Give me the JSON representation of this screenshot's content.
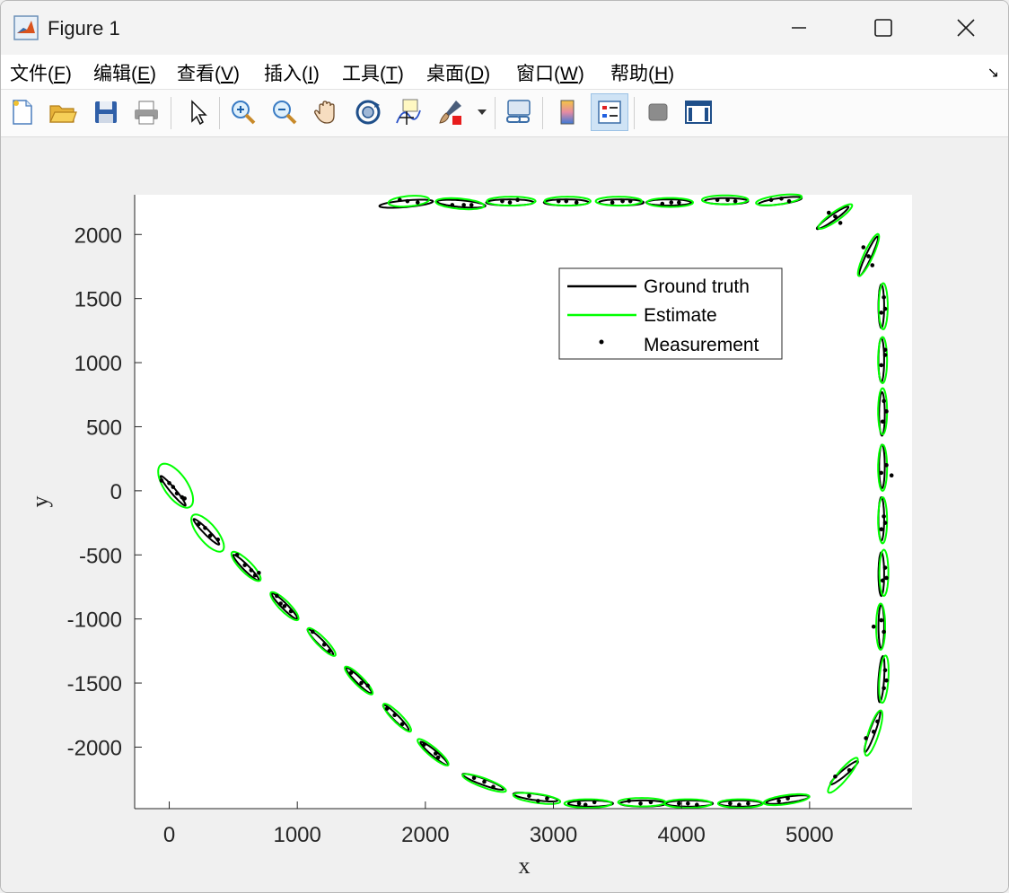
{
  "window": {
    "title": "Figure 1",
    "icon": "matlab-logo-icon"
  },
  "menubar": {
    "items": [
      {
        "label": "文件(",
        "key": "F",
        "tail": ")"
      },
      {
        "label": "编辑(",
        "key": "E",
        "tail": ")"
      },
      {
        "label": "查看(",
        "key": "V",
        "tail": ")"
      },
      {
        "label": "插入(",
        "key": "I",
        "tail": ")"
      },
      {
        "label": "工具(",
        "key": "T",
        "tail": ")"
      },
      {
        "label": "桌面(",
        "key": "D",
        "tail": ")"
      },
      {
        "label": "窗口(",
        "key": "W",
        "tail": ")"
      },
      {
        "label": "帮助(",
        "key": "H",
        "tail": ")"
      }
    ],
    "overflow_icon": "↘"
  },
  "toolbar": {
    "buttons": [
      "new-figure-icon",
      "open-file-icon",
      "save-icon",
      "print-icon",
      "edit-plot-arrow-icon",
      "zoom-in-icon",
      "zoom-out-icon",
      "pan-hand-icon",
      "rotate-3d-icon",
      "data-cursor-icon",
      "brush-icon",
      "link-plot-icon",
      "colorbar-icon",
      "legend-icon",
      "hide-plot-tools-icon",
      "show-plot-tools-icon"
    ],
    "active": "legend-icon"
  },
  "chart_data": {
    "type": "line",
    "xlabel": "x",
    "ylabel": "y",
    "xlim": [
      -270,
      5800
    ],
    "ylim": [
      -2480,
      2310
    ],
    "xticks": [
      0,
      1000,
      2000,
      3000,
      4000,
      5000
    ],
    "yticks": [
      -2000,
      -1500,
      -1000,
      -500,
      0,
      500,
      1000,
      1500,
      2000
    ],
    "legend": {
      "placement": "top-right-inside",
      "entries": [
        "Ground truth",
        "Estimate",
        "Measurement"
      ]
    },
    "colors": {
      "truth": "#000000",
      "estimate": "#00ff00",
      "measurement": "#000000"
    },
    "ground_truth_ellipses": [
      {
        "cx": 30,
        "cy": 0,
        "a": 150,
        "b": 20,
        "angle": -50
      },
      {
        "cx": 290,
        "cy": -320,
        "a": 140,
        "b": 20,
        "angle": -45
      },
      {
        "cx": 600,
        "cy": -600,
        "a": 140,
        "b": 22,
        "angle": -45
      },
      {
        "cx": 900,
        "cy": -900,
        "a": 140,
        "b": 22,
        "angle": -45
      },
      {
        "cx": 1180,
        "cy": -1180,
        "a": 140,
        "b": 22,
        "angle": -45
      },
      {
        "cx": 1480,
        "cy": -1480,
        "a": 140,
        "b": 22,
        "angle": -45
      },
      {
        "cx": 1770,
        "cy": -1770,
        "a": 140,
        "b": 22,
        "angle": -45
      },
      {
        "cx": 2070,
        "cy": -2050,
        "a": 140,
        "b": 22,
        "angle": -40
      },
      {
        "cx": 2450,
        "cy": -2270,
        "a": 170,
        "b": 24,
        "angle": -20
      },
      {
        "cx": 2860,
        "cy": -2390,
        "a": 175,
        "b": 24,
        "angle": -8
      },
      {
        "cx": 3290,
        "cy": -2440,
        "a": 175,
        "b": 24,
        "angle": 0
      },
      {
        "cx": 3700,
        "cy": -2440,
        "a": 180,
        "b": 24,
        "angle": 0
      },
      {
        "cx": 4060,
        "cy": -2440,
        "a": 185,
        "b": 24,
        "angle": 0
      },
      {
        "cx": 4460,
        "cy": -2440,
        "a": 170,
        "b": 24,
        "angle": 0
      },
      {
        "cx": 4830,
        "cy": -2410,
        "a": 170,
        "b": 24,
        "angle": 8
      },
      {
        "cx": 5270,
        "cy": -2200,
        "a": 140,
        "b": 22,
        "angle": 40
      },
      {
        "cx": 5490,
        "cy": -1880,
        "a": 170,
        "b": 22,
        "angle": 70
      },
      {
        "cx": 5560,
        "cy": -1470,
        "a": 180,
        "b": 22,
        "angle": 86
      },
      {
        "cx": 5560,
        "cy": -1060,
        "a": 170,
        "b": 22,
        "angle": 90
      },
      {
        "cx": 5560,
        "cy": -650,
        "a": 170,
        "b": 22,
        "angle": 90
      },
      {
        "cx": 5560,
        "cy": -220,
        "a": 170,
        "b": 22,
        "angle": 90
      },
      {
        "cx": 5565,
        "cy": 190,
        "a": 170,
        "b": 22,
        "angle": 90
      },
      {
        "cx": 5565,
        "cy": 600,
        "a": 170,
        "b": 22,
        "angle": 90
      },
      {
        "cx": 5560,
        "cy": 1020,
        "a": 170,
        "b": 22,
        "angle": 90
      },
      {
        "cx": 5560,
        "cy": 1440,
        "a": 170,
        "b": 22,
        "angle": 90
      },
      {
        "cx": 5460,
        "cy": 1830,
        "a": 170,
        "b": 22,
        "angle": 65
      },
      {
        "cx": 5180,
        "cy": 2130,
        "a": 150,
        "b": 22,
        "angle": 35
      },
      {
        "cx": 4770,
        "cy": 2260,
        "a": 170,
        "b": 24,
        "angle": 8
      },
      {
        "cx": 4350,
        "cy": 2260,
        "a": 170,
        "b": 24,
        "angle": 0
      },
      {
        "cx": 3900,
        "cy": 2250,
        "a": 175,
        "b": 24,
        "angle": 0
      },
      {
        "cx": 3530,
        "cy": 2250,
        "a": 175,
        "b": 24,
        "angle": 0
      },
      {
        "cx": 3100,
        "cy": 2250,
        "a": 175,
        "b": 24,
        "angle": 0
      },
      {
        "cx": 2660,
        "cy": 2250,
        "a": 185,
        "b": 24,
        "angle": 0
      },
      {
        "cx": 2280,
        "cy": 2240,
        "a": 190,
        "b": 26,
        "angle": -5
      },
      {
        "cx": 1850,
        "cy": 2240,
        "a": 210,
        "b": 26,
        "angle": 5
      }
    ],
    "estimate_ellipses": [
      {
        "cx": 50,
        "cy": 40,
        "a": 200,
        "b": 90,
        "angle": -55
      },
      {
        "cx": 300,
        "cy": -330,
        "a": 180,
        "b": 70,
        "angle": -50
      },
      {
        "cx": 600,
        "cy": -590,
        "a": 155,
        "b": 45,
        "angle": -45
      },
      {
        "cx": 900,
        "cy": -900,
        "a": 150,
        "b": 40,
        "angle": -45
      },
      {
        "cx": 1190,
        "cy": -1180,
        "a": 150,
        "b": 35,
        "angle": -45
      },
      {
        "cx": 1480,
        "cy": -1480,
        "a": 150,
        "b": 35,
        "angle": -45
      },
      {
        "cx": 1780,
        "cy": -1770,
        "a": 150,
        "b": 35,
        "angle": -45
      },
      {
        "cx": 2060,
        "cy": -2040,
        "a": 155,
        "b": 35,
        "angle": -40
      },
      {
        "cx": 2460,
        "cy": -2280,
        "a": 180,
        "b": 35,
        "angle": -20
      },
      {
        "cx": 2870,
        "cy": -2400,
        "a": 185,
        "b": 35,
        "angle": -8
      },
      {
        "cx": 3270,
        "cy": -2440,
        "a": 185,
        "b": 33,
        "angle": 0
      },
      {
        "cx": 3690,
        "cy": -2430,
        "a": 185,
        "b": 33,
        "angle": 0
      },
      {
        "cx": 4050,
        "cy": -2440,
        "a": 185,
        "b": 33,
        "angle": 0
      },
      {
        "cx": 4460,
        "cy": -2440,
        "a": 175,
        "b": 33,
        "angle": 0
      },
      {
        "cx": 4820,
        "cy": -2410,
        "a": 180,
        "b": 35,
        "angle": 8
      },
      {
        "cx": 5260,
        "cy": -2220,
        "a": 175,
        "b": 40,
        "angle": 50
      },
      {
        "cx": 5500,
        "cy": -1890,
        "a": 185,
        "b": 40,
        "angle": 72
      },
      {
        "cx": 5580,
        "cy": -1470,
        "a": 185,
        "b": 35,
        "angle": 86
      },
      {
        "cx": 5555,
        "cy": -1060,
        "a": 180,
        "b": 35,
        "angle": 90
      },
      {
        "cx": 5580,
        "cy": -640,
        "a": 180,
        "b": 35,
        "angle": 90
      },
      {
        "cx": 5570,
        "cy": -230,
        "a": 180,
        "b": 35,
        "angle": 90
      },
      {
        "cx": 5570,
        "cy": 180,
        "a": 180,
        "b": 35,
        "angle": 90
      },
      {
        "cx": 5570,
        "cy": 620,
        "a": 180,
        "b": 35,
        "angle": 90
      },
      {
        "cx": 5570,
        "cy": 1020,
        "a": 180,
        "b": 35,
        "angle": 90
      },
      {
        "cx": 5575,
        "cy": 1440,
        "a": 180,
        "b": 35,
        "angle": 90
      },
      {
        "cx": 5460,
        "cy": 1840,
        "a": 180,
        "b": 35,
        "angle": 65
      },
      {
        "cx": 5200,
        "cy": 2140,
        "a": 160,
        "b": 35,
        "angle": 35
      },
      {
        "cx": 4760,
        "cy": 2270,
        "a": 180,
        "b": 35,
        "angle": 8
      },
      {
        "cx": 4340,
        "cy": 2270,
        "a": 180,
        "b": 35,
        "angle": 0
      },
      {
        "cx": 3910,
        "cy": 2250,
        "a": 180,
        "b": 35,
        "angle": 0
      },
      {
        "cx": 3510,
        "cy": 2260,
        "a": 180,
        "b": 35,
        "angle": 0
      },
      {
        "cx": 3110,
        "cy": 2260,
        "a": 180,
        "b": 35,
        "angle": 0
      },
      {
        "cx": 2670,
        "cy": 2260,
        "a": 190,
        "b": 35,
        "angle": 0
      },
      {
        "cx": 2270,
        "cy": 2240,
        "a": 190,
        "b": 40,
        "angle": -5
      },
      {
        "cx": 1870,
        "cy": 2260,
        "a": 160,
        "b": 40,
        "angle": 5
      }
    ],
    "measurements": [
      [
        -60,
        80
      ],
      [
        0,
        60
      ],
      [
        30,
        30
      ],
      [
        60,
        -20
      ],
      [
        100,
        -50
      ],
      [
        120,
        -60
      ],
      [
        230,
        -260
      ],
      [
        320,
        -350
      ],
      [
        380,
        -380
      ],
      [
        280,
        -290
      ],
      [
        530,
        -500
      ],
      [
        590,
        -580
      ],
      [
        640,
        -620
      ],
      [
        670,
        -660
      ],
      [
        700,
        -640
      ],
      [
        840,
        -820
      ],
      [
        900,
        -900
      ],
      [
        950,
        -940
      ],
      [
        870,
        -880
      ],
      [
        1120,
        -1100
      ],
      [
        1210,
        -1200
      ],
      [
        1250,
        -1250
      ],
      [
        1420,
        -1420
      ],
      [
        1500,
        -1500
      ],
      [
        1550,
        -1520
      ],
      [
        1700,
        -1700
      ],
      [
        1760,
        -1750
      ],
      [
        1820,
        -1820
      ],
      [
        1990,
        -1980
      ],
      [
        2080,
        -2050
      ],
      [
        2100,
        -2080
      ],
      [
        2380,
        -2240
      ],
      [
        2460,
        -2270
      ],
      [
        2530,
        -2310
      ],
      [
        2810,
        -2380
      ],
      [
        2880,
        -2420
      ],
      [
        2950,
        -2400
      ],
      [
        3200,
        -2440
      ],
      [
        3250,
        -2450
      ],
      [
        3320,
        -2430
      ],
      [
        3590,
        -2420
      ],
      [
        3680,
        -2440
      ],
      [
        3760,
        -2430
      ],
      [
        3980,
        -2440
      ],
      [
        4050,
        -2440
      ],
      [
        4120,
        -2450
      ],
      [
        4380,
        -2440
      ],
      [
        4450,
        -2450
      ],
      [
        4520,
        -2440
      ],
      [
        4760,
        -2420
      ],
      [
        4830,
        -2400
      ],
      [
        5200,
        -2230
      ],
      [
        5310,
        -2180
      ],
      [
        5440,
        -1930
      ],
      [
        5500,
        -1880
      ],
      [
        5530,
        -1800
      ],
      [
        5580,
        -1540
      ],
      [
        5600,
        -1480
      ],
      [
        5590,
        -1400
      ],
      [
        5500,
        -1060
      ],
      [
        5560,
        -1010
      ],
      [
        5580,
        -1100
      ],
      [
        5570,
        -700
      ],
      [
        5590,
        -600
      ],
      [
        5600,
        -680
      ],
      [
        5560,
        -300
      ],
      [
        5580,
        -200
      ],
      [
        5590,
        -250
      ],
      [
        5560,
        140
      ],
      [
        5600,
        200
      ],
      [
        5640,
        120
      ],
      [
        5570,
        540
      ],
      [
        5600,
        620
      ],
      [
        5580,
        700
      ],
      [
        5560,
        980
      ],
      [
        5590,
        1060
      ],
      [
        5590,
        1100
      ],
      [
        5560,
        1390
      ],
      [
        5590,
        1420
      ],
      [
        5580,
        1510
      ],
      [
        5420,
        1900
      ],
      [
        5460,
        1830
      ],
      [
        5490,
        1760
      ],
      [
        5150,
        2170
      ],
      [
        5200,
        2140
      ],
      [
        5240,
        2090
      ],
      [
        4700,
        2270
      ],
      [
        4780,
        2280
      ],
      [
        4840,
        2260
      ],
      [
        4280,
        2270
      ],
      [
        4360,
        2270
      ],
      [
        4420,
        2260
      ],
      [
        3850,
        2240
      ],
      [
        3920,
        2250
      ],
      [
        3980,
        2250
      ],
      [
        3460,
        2250
      ],
      [
        3540,
        2260
      ],
      [
        3600,
        2260
      ],
      [
        3040,
        2260
      ],
      [
        3100,
        2260
      ],
      [
        3180,
        2250
      ],
      [
        2600,
        2260
      ],
      [
        2660,
        2250
      ],
      [
        2720,
        2270
      ],
      [
        2210,
        2230
      ],
      [
        2300,
        2230
      ],
      [
        2360,
        2230
      ],
      [
        1800,
        2270
      ],
      [
        1860,
        2260
      ],
      [
        1940,
        2250
      ]
    ]
  }
}
